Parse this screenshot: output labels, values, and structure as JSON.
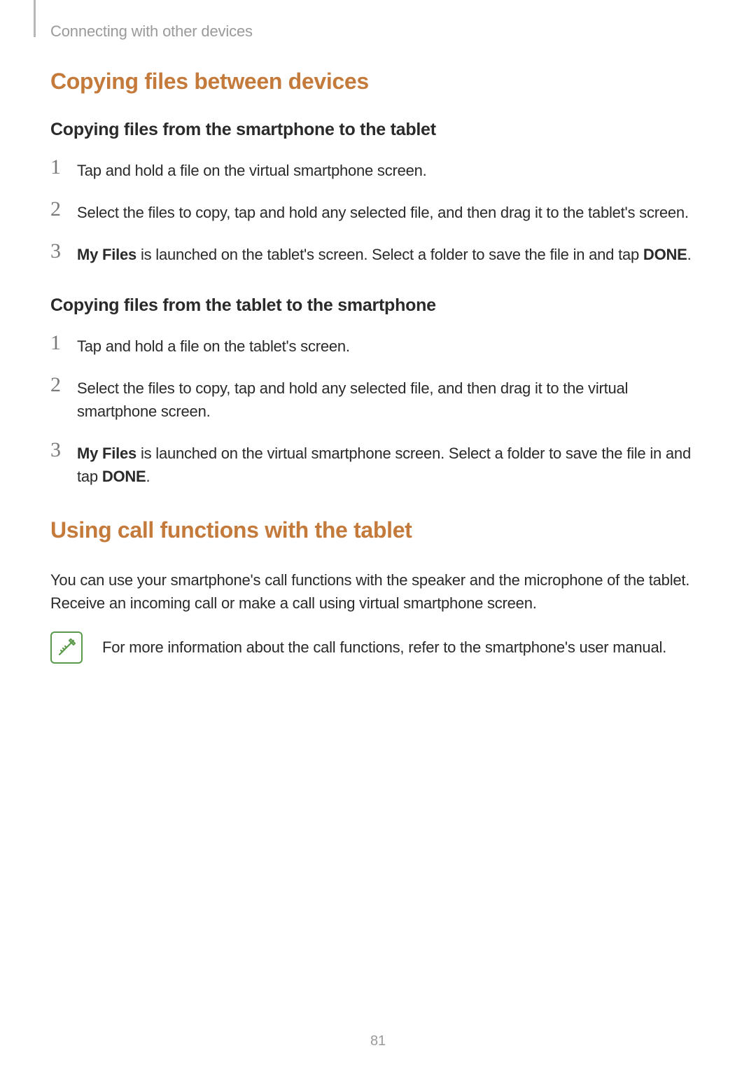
{
  "breadcrumb": "Connecting with other devices",
  "section1": {
    "title": "Copying files between devices",
    "sub1": {
      "title": "Copying files from the smartphone to the tablet",
      "steps": {
        "n1": "1",
        "t1": "Tap and hold a file on the virtual smartphone screen.",
        "n2": "2",
        "t2": "Select the files to copy, tap and hold any selected file, and then drag it to the tablet's screen.",
        "n3": "3",
        "t3_bold1": "My Files",
        "t3_tail": " is launched on the tablet's screen. Select a folder to save the file in and tap ",
        "t3_bold2": "DONE",
        "t3_end": "."
      }
    },
    "sub2": {
      "title": "Copying files from the tablet to the smartphone",
      "steps": {
        "n1": "1",
        "t1": "Tap and hold a file on the tablet's screen.",
        "n2": "2",
        "t2": "Select the files to copy, tap and hold any selected file, and then drag it to the virtual smartphone screen.",
        "n3": "3",
        "t3_bold1": "My Files",
        "t3_tail": " is launched on the virtual smartphone screen. Select a folder to save the file in and tap ",
        "t3_bold2": "DONE",
        "t3_end": "."
      }
    }
  },
  "section2": {
    "title": "Using call functions with the tablet",
    "paragraph": "You can use your smartphone's call functions with the speaker and the microphone of the tablet. Receive an incoming call or make a call using virtual smartphone screen.",
    "note": "For more information about the call functions, refer to the smartphone's user manual."
  },
  "page_number": "81"
}
